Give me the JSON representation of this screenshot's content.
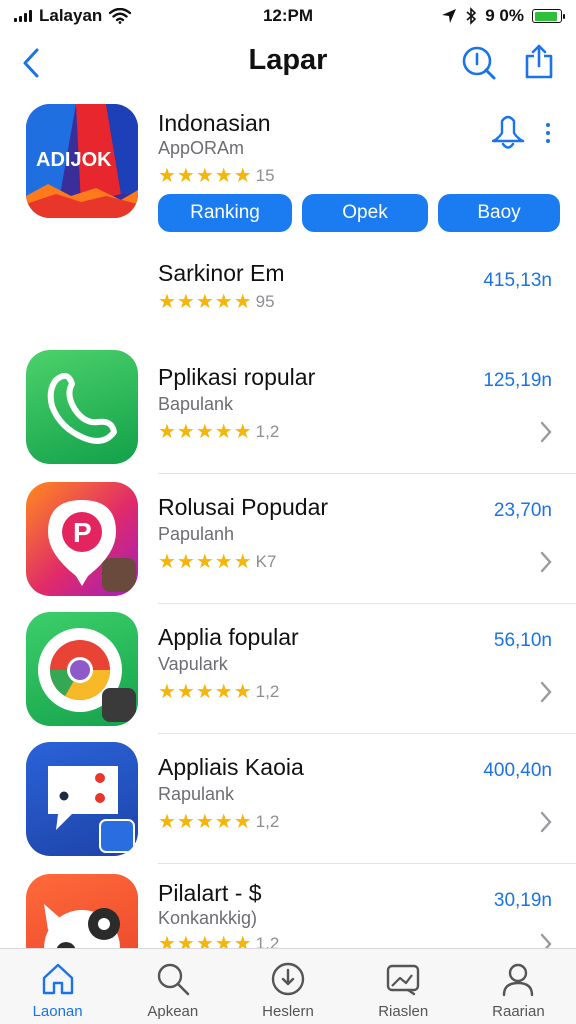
{
  "status_bar": {
    "carrier": "Lalayan",
    "time": "12:PM",
    "battery": "9 0%"
  },
  "nav": {
    "title": "Lapar"
  },
  "featured": {
    "icon_text": "ADIJOK",
    "name": "Indonasian",
    "subtitle": "AppORAm",
    "stars": "★★★★★",
    "rating": "15",
    "buttons": {
      "ranking": "Ranking",
      "opek": "Opek",
      "baoy": "Baoy"
    }
  },
  "apps": [
    {
      "name": "Sarkinor Em",
      "subtitle": "",
      "stars": "★★★★★",
      "rating": "95",
      "size": "415,13n"
    },
    {
      "name": "Pplikasi ropular",
      "subtitle": "Bapulank",
      "stars": "★★★★★",
      "rating": "1,2",
      "size": "125,19n"
    },
    {
      "name": "Rolusai Popudar",
      "subtitle": "Papulanh",
      "stars": "★★★★★",
      "rating": "K7",
      "size": "23,70n"
    },
    {
      "name": "Applia fopular",
      "subtitle": "Vapulark",
      "stars": "★★★★★",
      "rating": "1,2",
      "size": "56,10n"
    },
    {
      "name": "Appliais Kaoia",
      "subtitle": "Rapulank",
      "stars": "★★★★★",
      "rating": "1,2",
      "size": "400,40n"
    },
    {
      "name": "Pilalart - $",
      "subtitle": "Konkankkig)",
      "stars": "★★★★★",
      "rating": "1,2",
      "size": "30,19n"
    }
  ],
  "tabs": [
    {
      "label": "Laonan",
      "icon": "home-icon"
    },
    {
      "label": "Apkean",
      "icon": "search-icon"
    },
    {
      "label": "Heslern",
      "icon": "download-icon"
    },
    {
      "label": "Riaslen",
      "icon": "gallery-icon"
    },
    {
      "label": "Raarian",
      "icon": "person-icon"
    }
  ],
  "colors": {
    "accent": "#1a73e8",
    "star": "#f5b50a",
    "battery": "#2fbf3b"
  }
}
